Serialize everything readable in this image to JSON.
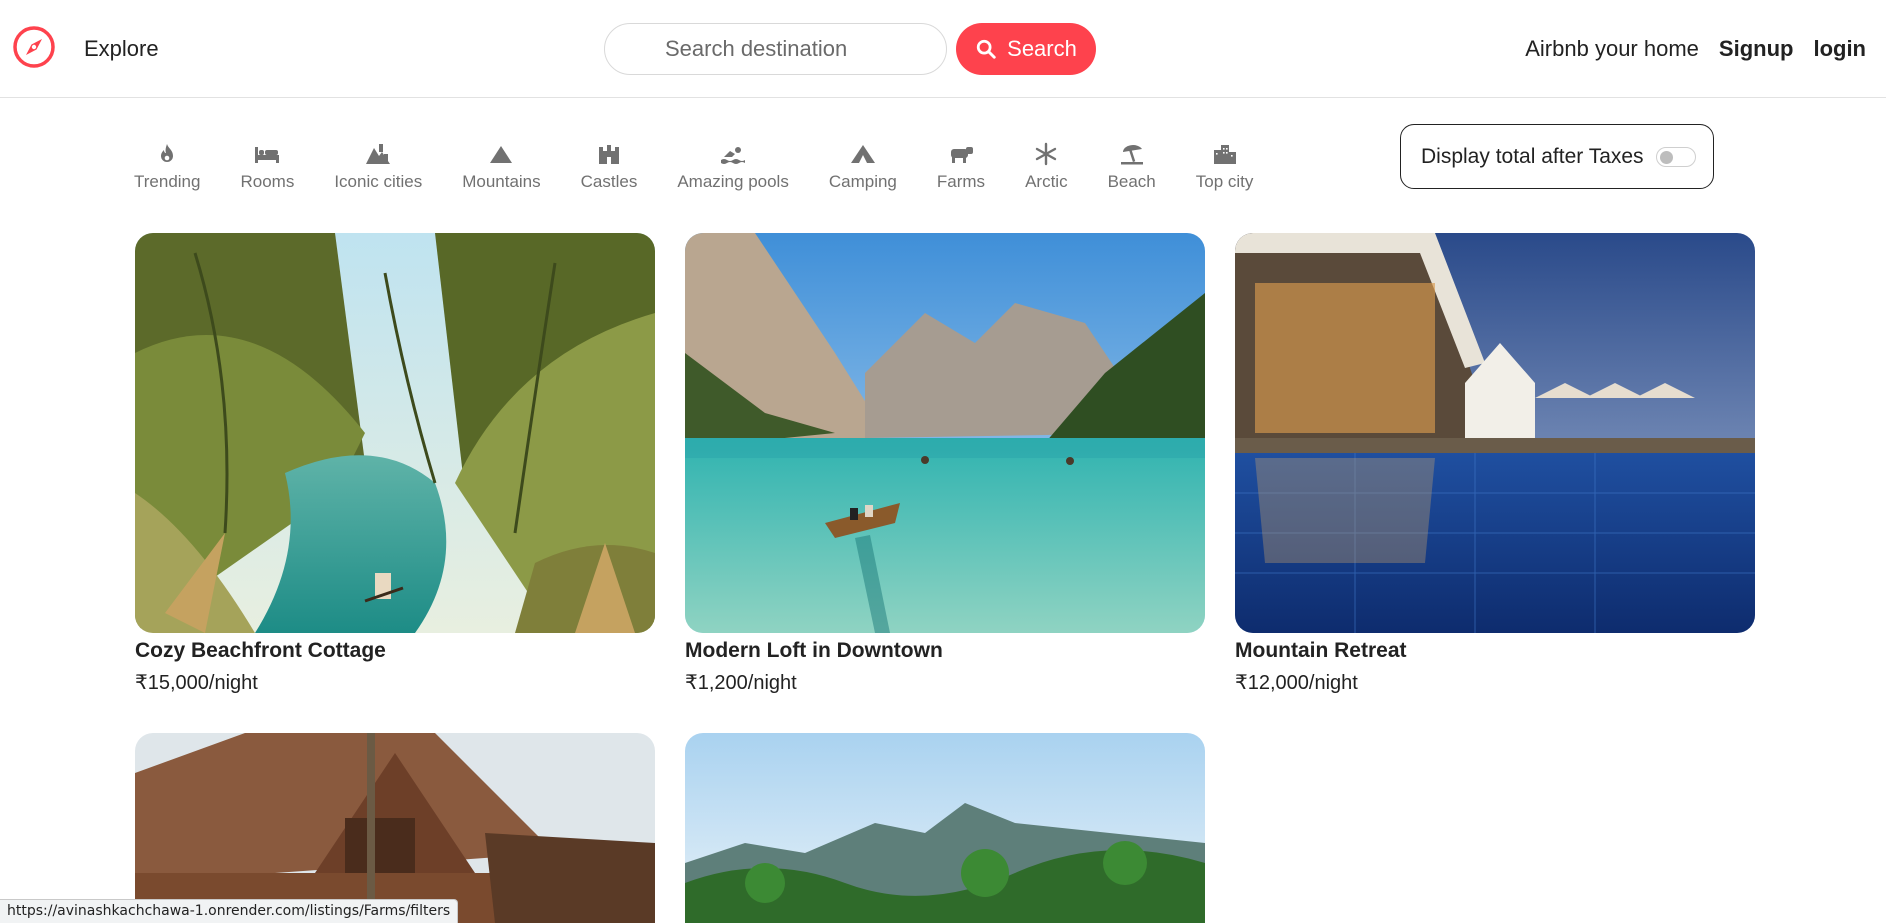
{
  "nav": {
    "explore_label": "Explore",
    "search_placeholder": "Search destination",
    "search_button_label": "Search",
    "host_link_label": "Airbnb your home",
    "signup_label": "Signup",
    "login_label": "login",
    "brand_color": "#fe424d",
    "logo_icon": "compass-icon"
  },
  "filters": [
    {
      "label": "Trending",
      "icon": "fire-icon"
    },
    {
      "label": "Rooms",
      "icon": "bed-icon"
    },
    {
      "label": "Iconic cities",
      "icon": "mountain-city-icon"
    },
    {
      "label": "Mountains",
      "icon": "mountain-icon"
    },
    {
      "label": "Castles",
      "icon": "castle-icon"
    },
    {
      "label": "Amazing pools",
      "icon": "person-swimming-icon"
    },
    {
      "label": "Camping",
      "icon": "campground-icon"
    },
    {
      "label": "Farms",
      "icon": "cow-icon"
    },
    {
      "label": "Arctic",
      "icon": "snowflake-icon"
    },
    {
      "label": "Beach",
      "icon": "umbrella-beach-icon"
    },
    {
      "label": "Top city",
      "icon": "city-icon"
    }
  ],
  "tax_toggle": {
    "label": "Display total after Taxes",
    "enabled": false
  },
  "listings": [
    {
      "title": "Cozy Beachfront Cottage",
      "price": "₹15,000/night"
    },
    {
      "title": "Modern Loft in Downtown",
      "price": "₹1,200/night"
    },
    {
      "title": "Mountain Retreat",
      "price": "₹12,000/night"
    },
    {
      "title": "",
      "price": ""
    },
    {
      "title": "",
      "price": ""
    }
  ],
  "status_bar": {
    "url": "https://avinashkachchawa-1.onrender.com/listings/Farms/filters"
  }
}
